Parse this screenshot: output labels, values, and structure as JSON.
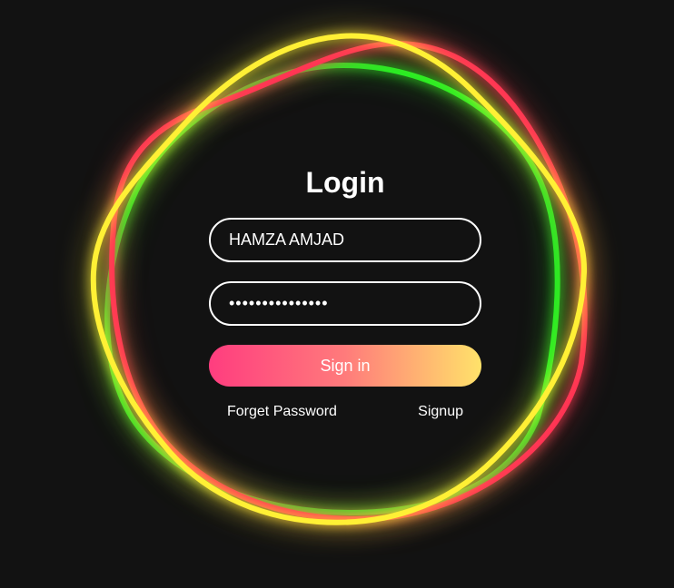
{
  "login": {
    "title": "Login",
    "username_value": "HAMZA AMJAD",
    "password_value": "•••••••••••••••",
    "signin_label": "Sign in",
    "forget_label": "Forget Password",
    "signup_label": "Signup"
  },
  "colors": {
    "background": "#121212",
    "ring_red": "#ff2d55",
    "ring_green": "#22ee22",
    "ring_yellow": "#fff035",
    "button_gradient_start": "#ff3d7f",
    "button_gradient_end": "#ffe26a"
  }
}
